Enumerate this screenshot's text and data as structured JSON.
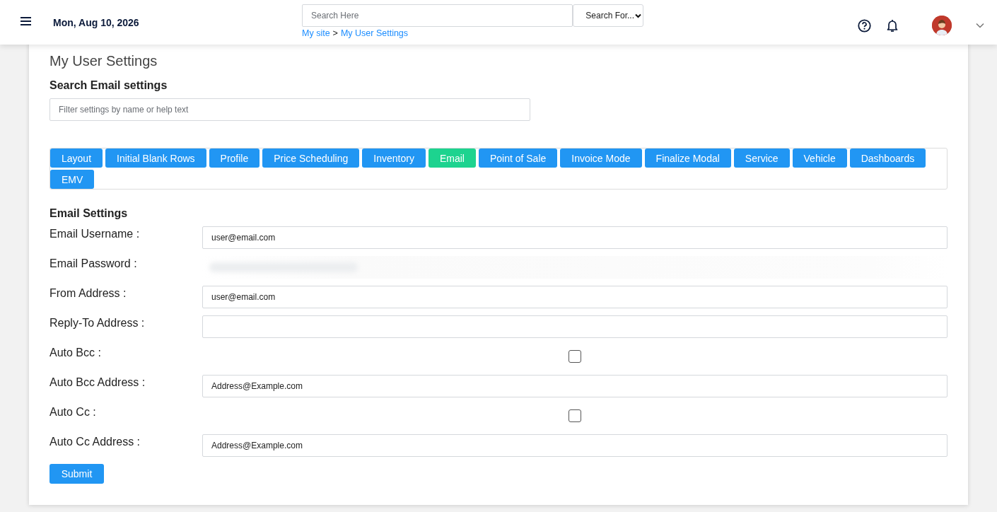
{
  "header": {
    "date": "Mon, Aug 10, 2026",
    "search": {
      "placeholder": "Search Here"
    },
    "search_for": {
      "value": "Search For..."
    },
    "breadcrumb": [
      "My site",
      "My User Settings"
    ],
    "breadcrumb_separator": ">"
  },
  "page": {
    "title": "My User Settings",
    "search_heading": "Search Email settings",
    "filter": {
      "placeholder": "Filter settings by name or help text"
    }
  },
  "tabs": [
    {
      "label": "Layout",
      "selected": false
    },
    {
      "label": "Initial Blank Rows",
      "selected": false
    },
    {
      "label": "Profile",
      "selected": false
    },
    {
      "label": "Price Scheduling",
      "selected": false
    },
    {
      "label": "Inventory",
      "selected": false
    },
    {
      "label": "Email",
      "selected": true
    },
    {
      "label": "Point of Sale",
      "selected": false
    },
    {
      "label": "Invoice Mode",
      "selected": false
    },
    {
      "label": "Finalize Modal",
      "selected": false
    },
    {
      "label": "Service",
      "selected": false
    },
    {
      "label": "Vehicle",
      "selected": false
    },
    {
      "label": "Dashboards",
      "selected": false
    },
    {
      "label": "EMV",
      "selected": false
    }
  ],
  "section_title": "Email Settings",
  "fields": [
    {
      "label": "Email Username :",
      "kind": "text",
      "value": "user@email.com"
    },
    {
      "label": "Email Password :",
      "kind": "blurred"
    },
    {
      "label": "From Address :",
      "kind": "text",
      "value": "user@email.com"
    },
    {
      "label": "Reply-To Address :",
      "kind": "text"
    },
    {
      "label": "Auto Bcc :",
      "kind": "checkbox",
      "checked": false
    },
    {
      "label": "Auto Bcc Address :",
      "kind": "text",
      "value": "Address@Example.com"
    },
    {
      "label": "Auto Cc :",
      "kind": "checkbox",
      "checked": false
    },
    {
      "label": "Auto Cc Address :",
      "kind": "text",
      "value": "Address@Example.com"
    }
  ],
  "submit": "Submit"
}
